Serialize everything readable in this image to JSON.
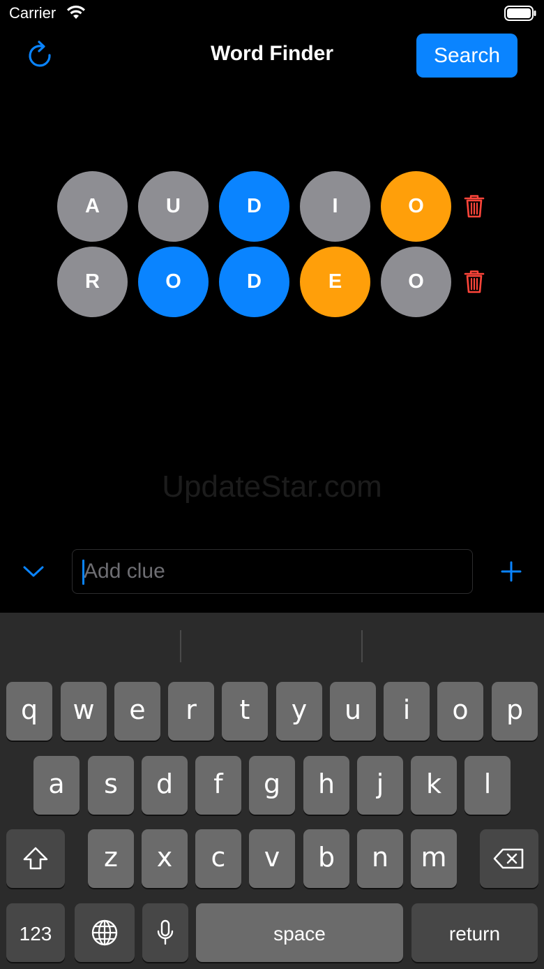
{
  "status_bar": {
    "carrier": "Carrier",
    "wifi_icon": "wifi-icon",
    "battery_icon": "battery-icon"
  },
  "nav": {
    "title": "Word Finder",
    "search_label": "Search",
    "refresh_icon": "refresh-icon"
  },
  "colors": {
    "accent": "#0a84ff",
    "tile_absent": "#8e8e93",
    "tile_present": "#ff9f0a",
    "tile_correct": "#0a84ff",
    "delete": "#ff453a"
  },
  "guesses": [
    {
      "tiles": [
        {
          "letter": "A",
          "state": "absent"
        },
        {
          "letter": "U",
          "state": "absent"
        },
        {
          "letter": "D",
          "state": "correct"
        },
        {
          "letter": "I",
          "state": "absent"
        },
        {
          "letter": "O",
          "state": "present"
        }
      ],
      "delete_icon": "trash-icon"
    },
    {
      "tiles": [
        {
          "letter": "R",
          "state": "absent"
        },
        {
          "letter": "O",
          "state": "correct"
        },
        {
          "letter": "D",
          "state": "correct"
        },
        {
          "letter": "E",
          "state": "present"
        },
        {
          "letter": "O",
          "state": "absent"
        }
      ],
      "delete_icon": "trash-icon"
    }
  ],
  "watermark": "UpdateStar.com",
  "clue_input": {
    "placeholder": "Add clue",
    "value": "",
    "collapse_icon": "chevron-down-icon",
    "add_icon": "plus-icon"
  },
  "keyboard": {
    "row1": [
      "q",
      "w",
      "e",
      "r",
      "t",
      "y",
      "u",
      "i",
      "o",
      "p"
    ],
    "row2": [
      "a",
      "s",
      "d",
      "f",
      "g",
      "h",
      "j",
      "k",
      "l"
    ],
    "row3": [
      "z",
      "x",
      "c",
      "v",
      "b",
      "n",
      "m"
    ],
    "numbers_label": "123",
    "space_label": "space",
    "return_label": "return",
    "shift_icon": "shift-icon",
    "delete_icon": "backspace-icon",
    "globe_icon": "globe-icon",
    "mic_icon": "microphone-icon"
  }
}
